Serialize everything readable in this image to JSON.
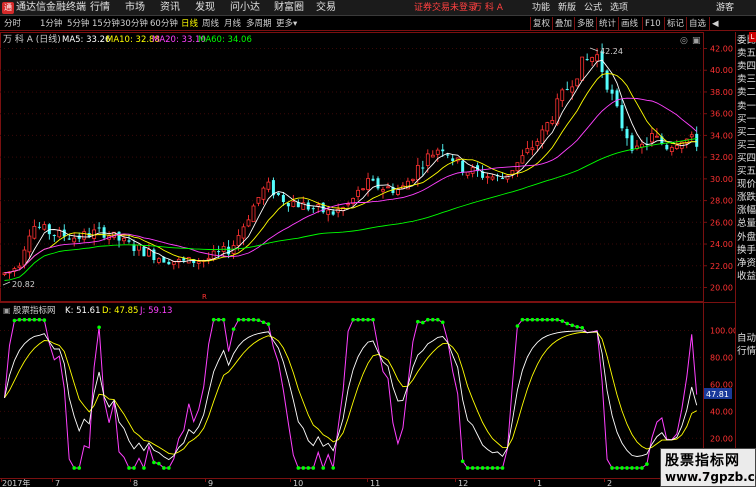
{
  "titlebar": {
    "app_title": "通达信金融终端",
    "menus": [
      "行情",
      "市场",
      "资讯",
      "发现",
      "问小达",
      "财富圈",
      "交易"
    ],
    "status_text": "证券交易未登录",
    "stock_text": "万 科 A",
    "right_menus": [
      "功能",
      "新版",
      "公式",
      "选项"
    ],
    "guest_label": "游客",
    "logo_glyph": "通"
  },
  "toolbar": {
    "periods": [
      "分时",
      "1分钟",
      "5分钟",
      "15分钟",
      "30分钟",
      "60分钟",
      "日线",
      "周线",
      "月线",
      "多周期",
      "更多"
    ],
    "active_period": "日线",
    "more_arrow": "▾",
    "right_tools": [
      "复权",
      "叠加",
      "多股",
      "统计",
      "画线",
      "F10",
      "标记",
      "自选"
    ],
    "back_arrow": "◀"
  },
  "main_chart": {
    "title": "万 科 A (日线)",
    "ma": [
      {
        "label": "MA5: 33.26",
        "color": "#ffffff"
      },
      {
        "label": "MA10: 32.88",
        "color": "#ffff00"
      },
      {
        "label": "MA20: 33.10",
        "color": "#ff40ff"
      },
      {
        "label": "MA60: 34.06",
        "color": "#00ff00"
      }
    ],
    "high_label": "42.24",
    "low_label": "20.82",
    "y_ticks": [
      "42.00",
      "40.00",
      "38.00",
      "36.00",
      "34.00",
      "32.00",
      "30.00",
      "28.00",
      "26.00",
      "24.00",
      "22.00",
      "20.00"
    ],
    "marker": "R"
  },
  "indicator": {
    "name": "股票指标网",
    "k_label": "K: 51.61",
    "d_label": "D: 47.85",
    "j_label": "J: 59.13",
    "y_ticks": [
      "100.00",
      "80.00",
      "60.00",
      "40.00",
      "20.00"
    ],
    "current_value": "47.81"
  },
  "x_axis": {
    "labels": [
      "2017年",
      "7",
      "8",
      "9",
      "10",
      "11",
      "12",
      "1",
      "2"
    ]
  },
  "colors": {
    "up": "#ff3232",
    "down": "#54fcfc",
    "ma5": "#ffffff",
    "ma10": "#ffff00",
    "ma20": "#ff40ff",
    "ma60": "#00ff00",
    "k": "#ffffff",
    "d": "#ffff00",
    "j": "#ff40ff",
    "frame": "#7a1010"
  },
  "side_panel": {
    "top_items": [
      "委比",
      "卖五",
      "卖四",
      "卖三",
      "卖二",
      "卖一",
      "买一",
      "买二",
      "买三",
      "买四",
      "买五",
      "现价",
      "涨跌",
      "涨幅",
      "总量",
      "外盘",
      "换手",
      "净资",
      "收益"
    ],
    "bottom_items": [
      "自动",
      "行情"
    ],
    "badge": "L"
  },
  "watermark": {
    "line1": "股票指标网",
    "line2": "www.7gpzb.com"
  }
}
